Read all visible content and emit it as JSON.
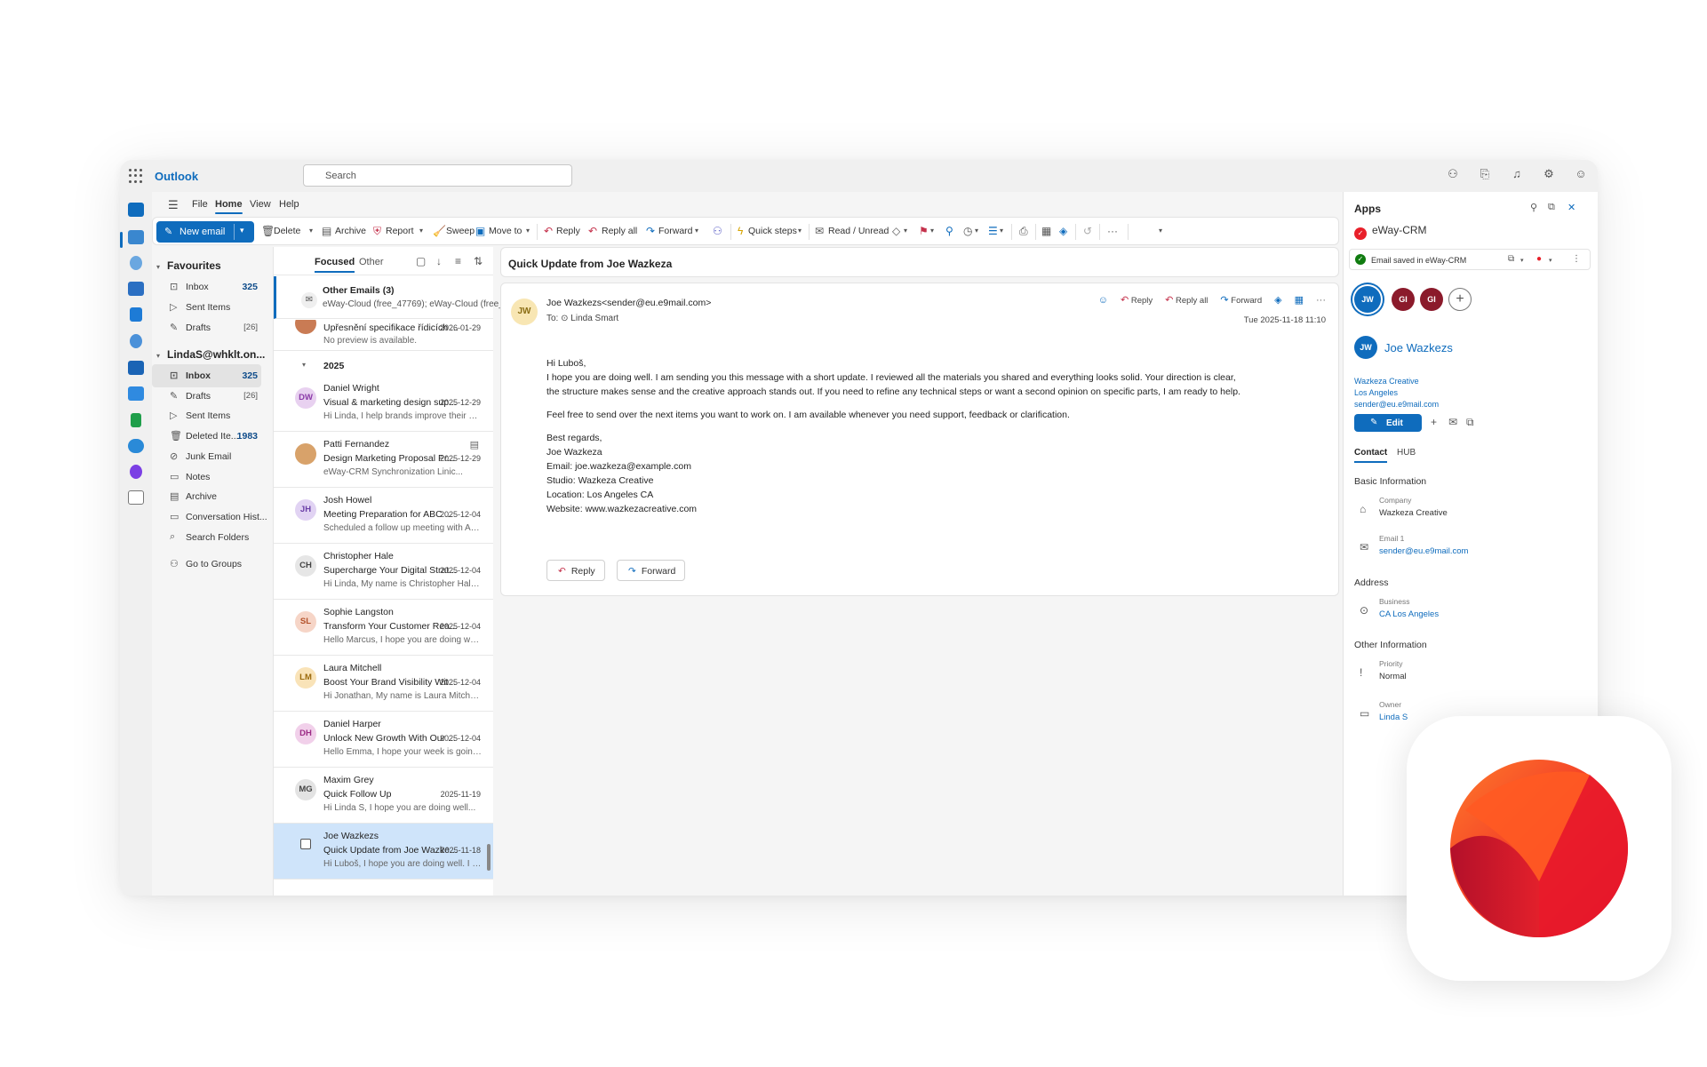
{
  "app": {
    "name": "Outlook"
  },
  "search": {
    "placeholder": "Search"
  },
  "menu": {
    "items": [
      "File",
      "Home",
      "View",
      "Help"
    ],
    "active": "Home"
  },
  "ribbon": {
    "new_email": "New email",
    "delete": "Delete",
    "archive": "Archive",
    "report": "Report",
    "sweep": "Sweep",
    "move_to": "Move to",
    "reply": "Reply",
    "reply_all": "Reply all",
    "forward": "Forward",
    "quick_steps": "Quick steps",
    "read_unread": "Read / Unread",
    "more": "···"
  },
  "folders": {
    "favourites_title": "Favourites",
    "favourites": [
      {
        "label": "Inbox",
        "count": "325"
      },
      {
        "label": "Sent Items",
        "count": ""
      },
      {
        "label": "Drafts",
        "count": "[26]"
      }
    ],
    "account_title": "LindaS@whklt.on...",
    "account": [
      {
        "label": "Inbox",
        "count": "325"
      },
      {
        "label": "Drafts",
        "count": "[26]"
      },
      {
        "label": "Sent Items",
        "count": ""
      },
      {
        "label": "Deleted Ite...",
        "count": "1983"
      },
      {
        "label": "Junk Email",
        "count": ""
      },
      {
        "label": "Notes",
        "count": ""
      },
      {
        "label": "Archive",
        "count": ""
      },
      {
        "label": "Conversation Hist...",
        "count": ""
      },
      {
        "label": "Search Folders",
        "count": ""
      }
    ],
    "groups": "Go to Groups"
  },
  "list": {
    "tab_focused": "Focused",
    "tab_other": "Other",
    "other_emails_title": "Other Emails (3)",
    "other_emails_preview": "eWay-Cloud (free_47769); eWay-Cloud (free_44...",
    "partial": {
      "subject": "Upřesnění specifikace řídicích ...",
      "date": "2026-01-29",
      "preview": "No preview is available."
    },
    "group_label": "2025",
    "items": [
      {
        "initials": "DW",
        "name": "Daniel Wright",
        "subject": "Visual & marketing design sup...",
        "date": "2025-12-29",
        "preview": "Hi Linda, I help brands improve their visual..."
      },
      {
        "initials": "",
        "name": "Patti Fernandez",
        "subject": "Design Marketing Proposal Pr...",
        "date": "2025-12-29",
        "preview": "eWay-CRM Synchronization Linic..."
      },
      {
        "initials": "JH",
        "name": "Josh Howel",
        "subject": "Meeting Preparation for ABC ...",
        "date": "2025-12-04",
        "preview": "Scheduled a follow up meeting with ABC..."
      },
      {
        "initials": "CH",
        "name": "Christopher Hale",
        "subject": "Supercharge Your Digital Strat...",
        "date": "2025-12-04",
        "preview": "Hi Linda, My name is Christopher Hale and..."
      },
      {
        "initials": "SL",
        "name": "Sophie Langston",
        "subject": "Transform Your Customer Rea...",
        "date": "2025-12-04",
        "preview": "Hello Marcus, I hope you are doing well. M..."
      },
      {
        "initials": "LM",
        "name": "Laura Mitchell",
        "subject": "Boost Your Brand Visibility Wit...",
        "date": "2025-12-04",
        "preview": "Hi Jonathan, My name is Laura Mitchell an..."
      },
      {
        "initials": "DH",
        "name": "Daniel Harper",
        "subject": "Unlock New Growth With Our ...",
        "date": "2025-12-04",
        "preview": "Hello Emma, I hope your week is going wel..."
      },
      {
        "initials": "MG",
        "name": "Maxim Grey",
        "subject": "Quick Follow Up",
        "date": "2025-11-19",
        "preview": "Hi Linda S, I hope you are doing well..."
      },
      {
        "initials": "",
        "name": "Joe Wazkezs",
        "subject": "Quick Update from Joe Wazke...",
        "date": "2025-11-18",
        "preview": "Hi Luboš, I hope you are doing well. I am..."
      }
    ]
  },
  "reading": {
    "subject": "Quick Update from Joe Wazkeza",
    "sender_initials": "JW",
    "from": "Joe Wazkezs<sender@eu.e9mail.com>",
    "to_label": "To:",
    "to": "Linda Smart",
    "date": "Tue 2025-11-18 11:10",
    "actions": {
      "reply": "Reply",
      "reply_all": "Reply all",
      "forward": "Forward"
    },
    "greeting": "Hi Luboš,",
    "para1": "I hope you are doing well. I am sending you this message with a short update. I reviewed all the materials you shared and everything looks solid. Your direction is clear, the structure makes sense and the creative approach stands out. If you need to refine any technical steps or want a second opinion on specific parts, I am ready to help.",
    "para2": "Feel free to send over the next items you want to work on. I am available whenever you need support, feedback or clarification.",
    "sig": [
      "Best regards,",
      "Joe Wazkeza",
      "Email: joe.wazkeza@example.com",
      "Studio: Wazkeza Creative",
      "Location: Los Angeles CA",
      "Website: www.wazkezacreative.com"
    ],
    "btn_reply": "Reply",
    "btn_forward": "Forward"
  },
  "side": {
    "title": "Apps",
    "app_name": "eWay-CRM",
    "saved": "Email saved in eWay-CRM",
    "avatars": [
      "JW",
      "GI",
      "GI"
    ],
    "contact_initials": "JW",
    "contact_name": "Joe Wazkezs",
    "company_link": "Wazkeza Creative",
    "city_link": "Los Angeles",
    "email_link": "sender@eu.e9mail.com",
    "edit": "Edit",
    "tab_contact": "Contact",
    "tab_hub": "HUB",
    "basic_info": "Basic Information",
    "company_label": "Company",
    "company_value": "Wazkeza Creative",
    "email1_label": "Email 1",
    "email1_value": "sender@eu.e9mail.com",
    "address": "Address",
    "business_label": "Business",
    "business_value": "CA Los Angeles",
    "other_info": "Other Information",
    "priority_label": "Priority",
    "priority_value": "Normal",
    "owner_label": "Owner",
    "owner_value": "Linda S"
  },
  "colors": {
    "accent": "#0f6cbd",
    "brand_red": "#e8202a"
  }
}
